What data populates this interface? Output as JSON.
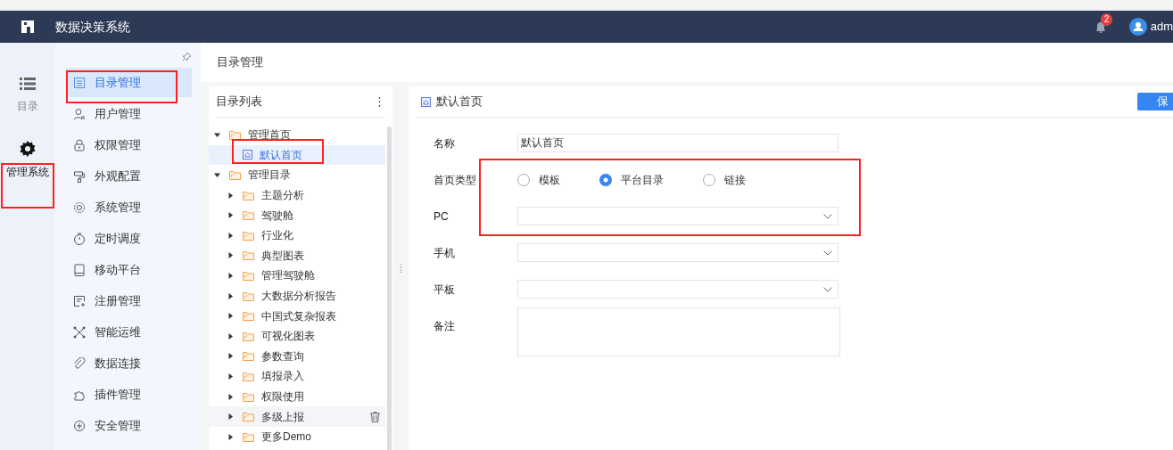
{
  "header": {
    "title": "数据决策系统",
    "notification_count": "2",
    "user": "adm"
  },
  "rail": [
    {
      "label": "目录",
      "selected": false
    },
    {
      "label": "管理系统",
      "selected": true
    }
  ],
  "menu": [
    {
      "label": "目录管理",
      "selected": true
    },
    {
      "label": "用户管理",
      "selected": false
    },
    {
      "label": "权限管理",
      "selected": false
    },
    {
      "label": "外观配置",
      "selected": false
    },
    {
      "label": "系统管理",
      "selected": false
    },
    {
      "label": "定时调度",
      "selected": false
    },
    {
      "label": "移动平台",
      "selected": false
    },
    {
      "label": "注册管理",
      "selected": false
    },
    {
      "label": "智能运维",
      "selected": false
    },
    {
      "label": "数据连接",
      "selected": false
    },
    {
      "label": "插件管理",
      "selected": false
    },
    {
      "label": "安全管理",
      "selected": false
    }
  ],
  "breadcrumb": "目录管理",
  "tree_panel": {
    "title": "目录列表",
    "more": "⋮",
    "items": [
      {
        "label": "管理首页",
        "kind": "folder",
        "expanded": true,
        "selected": false,
        "children": [
          {
            "label": "默认首页",
            "kind": "page",
            "selected": true
          }
        ]
      },
      {
        "label": "管理目录",
        "kind": "folder",
        "expanded": true,
        "selected": false,
        "children": [
          {
            "label": "主题分析",
            "kind": "folder",
            "expanded": false,
            "selected": false
          },
          {
            "label": "驾驶舱",
            "kind": "folder",
            "expanded": false,
            "selected": false
          },
          {
            "label": "行业化",
            "kind": "folder",
            "expanded": false,
            "selected": false
          },
          {
            "label": "典型图表",
            "kind": "folder",
            "expanded": false,
            "selected": false
          },
          {
            "label": "管理驾驶舱",
            "kind": "folder",
            "expanded": false,
            "selected": false
          },
          {
            "label": "大数据分析报告",
            "kind": "folder",
            "expanded": false,
            "selected": false
          },
          {
            "label": "中国式复杂报表",
            "kind": "folder",
            "expanded": false,
            "selected": false
          },
          {
            "label": "可视化图表",
            "kind": "folder",
            "expanded": false,
            "selected": false
          },
          {
            "label": "参数查询",
            "kind": "folder",
            "expanded": false,
            "selected": false
          },
          {
            "label": "填报录入",
            "kind": "folder",
            "expanded": false,
            "selected": false
          },
          {
            "label": "权限使用",
            "kind": "folder",
            "expanded": false,
            "selected": false
          },
          {
            "label": "多级上报",
            "kind": "folder",
            "expanded": false,
            "selected": false,
            "hovered": true
          },
          {
            "label": "更多Demo",
            "kind": "folder",
            "expanded": false,
            "selected": false
          }
        ]
      }
    ]
  },
  "detail": {
    "title": "默认首页",
    "save": "保",
    "fields": [
      {
        "label": "名称",
        "kind": "text",
        "value": "默认首页"
      },
      {
        "label": "首页类型",
        "kind": "radio",
        "options": [
          {
            "label": "模板",
            "selected": false
          },
          {
            "label": "平台目录",
            "selected": true
          },
          {
            "label": "链接",
            "selected": false
          }
        ]
      },
      {
        "label": "PC",
        "kind": "select"
      },
      {
        "label": "手机",
        "kind": "select"
      },
      {
        "label": "平板",
        "kind": "select"
      },
      {
        "label": "备注",
        "kind": "textarea"
      }
    ]
  }
}
